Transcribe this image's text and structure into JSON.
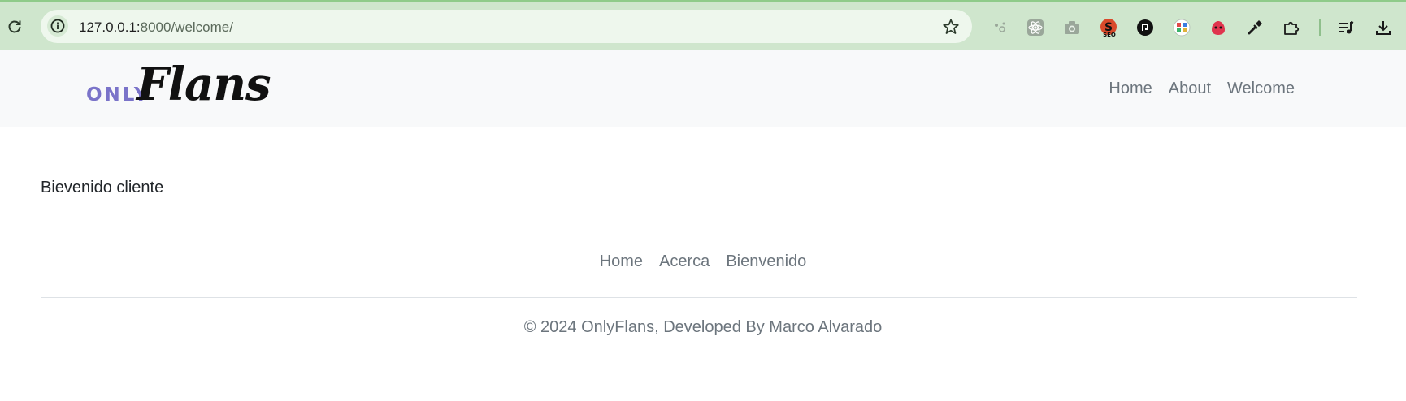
{
  "browser": {
    "url_host": "127.0.0.1:",
    "url_path": "8000/welcome/",
    "extensions": [
      "sparkle-icon",
      "react-devtools-icon",
      "camera-icon",
      "seo-extension-icon",
      "circle-extension-icon",
      "grid-extension-icon",
      "bug-extension-icon",
      "eyedropper-icon",
      "puzzle-icon",
      "playlist-icon",
      "download-icon"
    ]
  },
  "navbar": {
    "logo_small": "ONLY",
    "logo_script": "Flans",
    "links": [
      "Home",
      "About",
      "Welcome"
    ]
  },
  "main": {
    "text": "Bievenido cliente"
  },
  "footer": {
    "links": [
      "Home",
      "Acerca",
      "Bienvenido"
    ],
    "copyright": "© 2024 OnlyFlans, Developed By Marco Alvarado"
  },
  "colors": {
    "chrome_bg": "#cfe6cd",
    "navbar_bg": "#f8f9fa",
    "logo_accent": "#7a73c9",
    "link": "#6c757d"
  }
}
